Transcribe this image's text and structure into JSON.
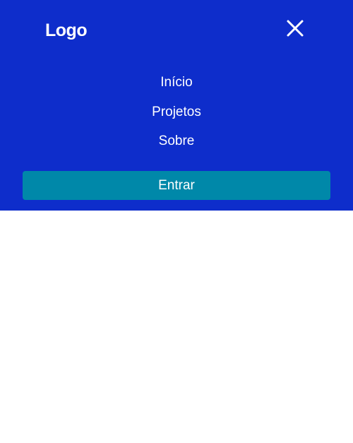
{
  "header": {
    "logo_text": "Logo",
    "close_icon": "close-icon"
  },
  "nav": {
    "items": [
      {
        "label": "Início"
      },
      {
        "label": "Projetos"
      },
      {
        "label": "Sobre"
      }
    ]
  },
  "actions": {
    "login_label": "Entrar"
  },
  "colors": {
    "menu_background": "#0e2dcb",
    "button_background": "#0088a9",
    "text": "#ffffff",
    "page_background": "#ffffff"
  }
}
